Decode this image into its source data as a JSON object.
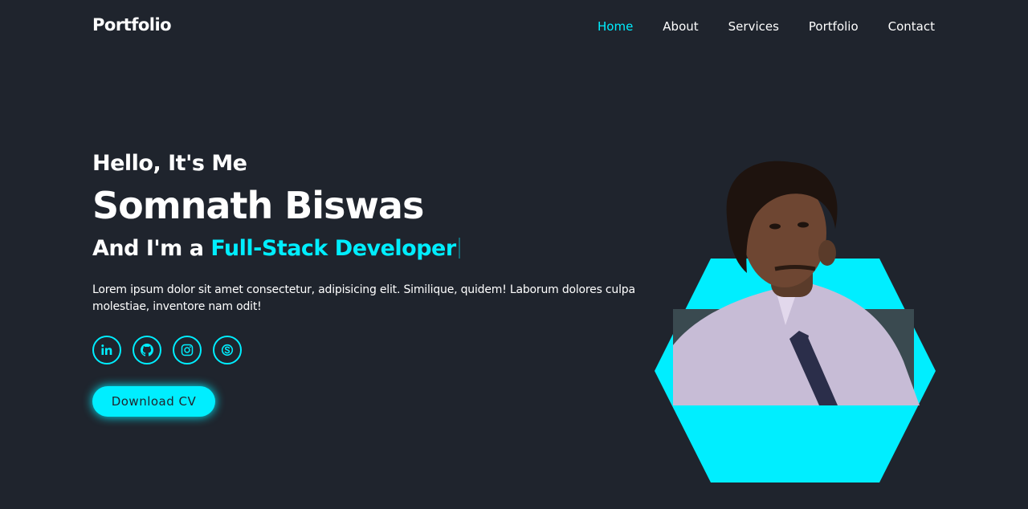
{
  "header": {
    "logo": "Portfolio",
    "nav": [
      {
        "label": "Home",
        "active": true
      },
      {
        "label": "About",
        "active": false
      },
      {
        "label": "Services",
        "active": false
      },
      {
        "label": "Portfolio",
        "active": false
      },
      {
        "label": "Contact",
        "active": false
      }
    ]
  },
  "home": {
    "greeting": "Hello, It's Me",
    "name": "Somnath Biswas",
    "role_prefix": "And I'm a ",
    "role_highlight": "Full-Stack Developer",
    "description": "Lorem ipsum dolor sit amet consectetur, adipisicing elit. Similique, quidem! Laborum dolores culpa molestiae, inventore nam odit!",
    "social_icons": [
      "linkedin-icon",
      "github-icon",
      "instagram-icon",
      "skype-icon"
    ],
    "cta_label": "Download CV"
  },
  "colors": {
    "background": "#1f242d",
    "accent": "#00eeff",
    "text": "#ffffff"
  }
}
